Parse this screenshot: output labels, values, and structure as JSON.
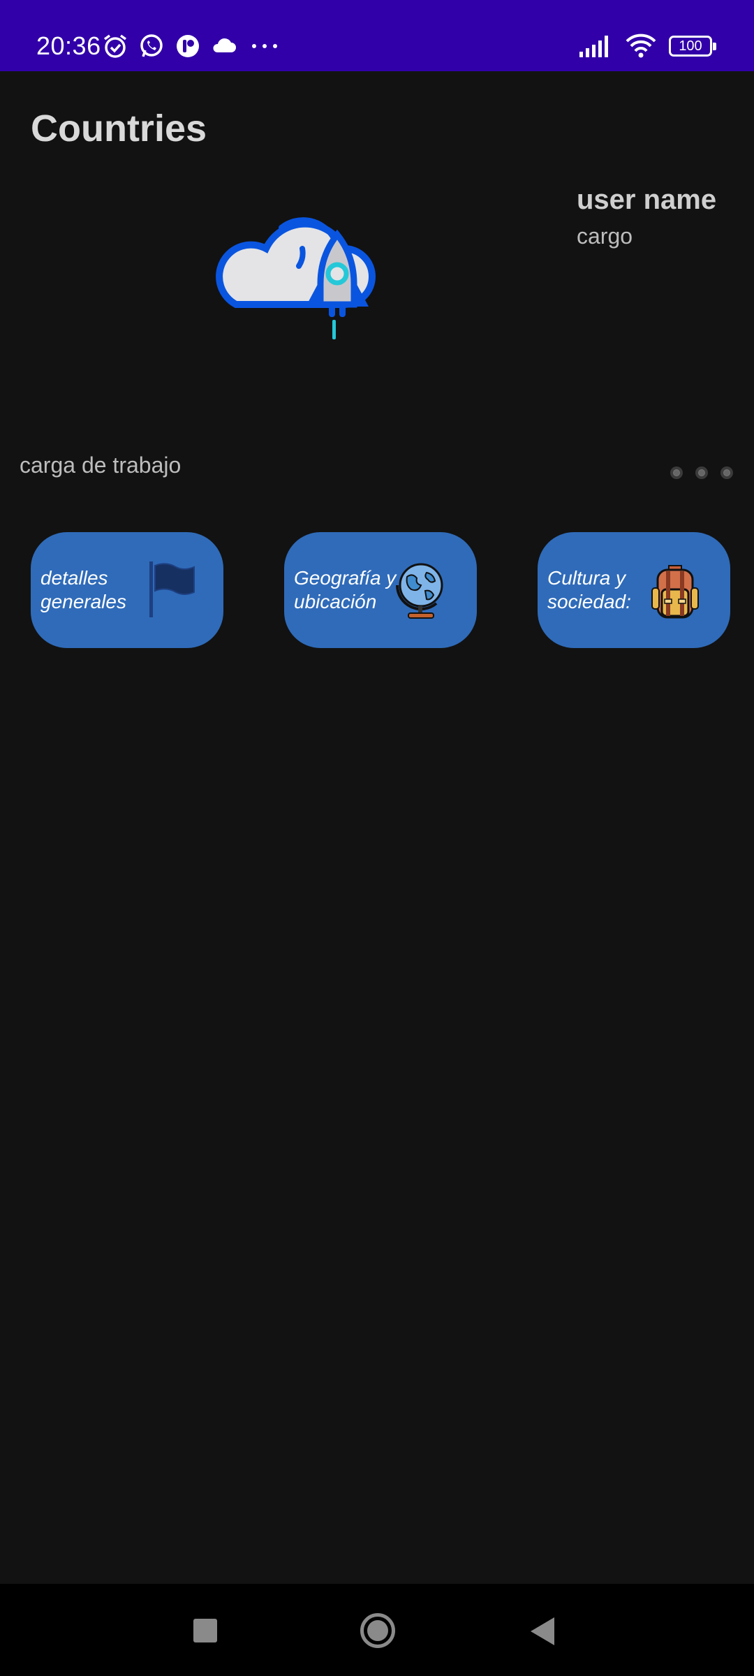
{
  "status_bar": {
    "time": "20:36",
    "battery": "100",
    "icons_left": [
      "alarm-icon",
      "whatsapp-icon",
      "app-notification-icon",
      "cloud-icon",
      "more-notifications-icon"
    ],
    "icons_right": [
      "signal-icon",
      "wifi-icon",
      "battery-icon"
    ]
  },
  "header": {
    "title": "Countries"
  },
  "profile": {
    "user_name": "user name",
    "cargo": "cargo"
  },
  "workload": {
    "label": "carga de trabajo"
  },
  "cards": [
    {
      "label": "detalles generales",
      "icon": "flag-icon"
    },
    {
      "label": "Geografía y ubicación",
      "icon": "globe-icon"
    },
    {
      "label": "Cultura y sociedad:",
      "icon": "backpack-icon"
    }
  ],
  "colors": {
    "status_bar": "#3100a8",
    "background": "#121212",
    "card": "#2f6bb9"
  },
  "nav_bar": {
    "buttons": [
      "recents-button",
      "home-button",
      "back-button"
    ]
  }
}
